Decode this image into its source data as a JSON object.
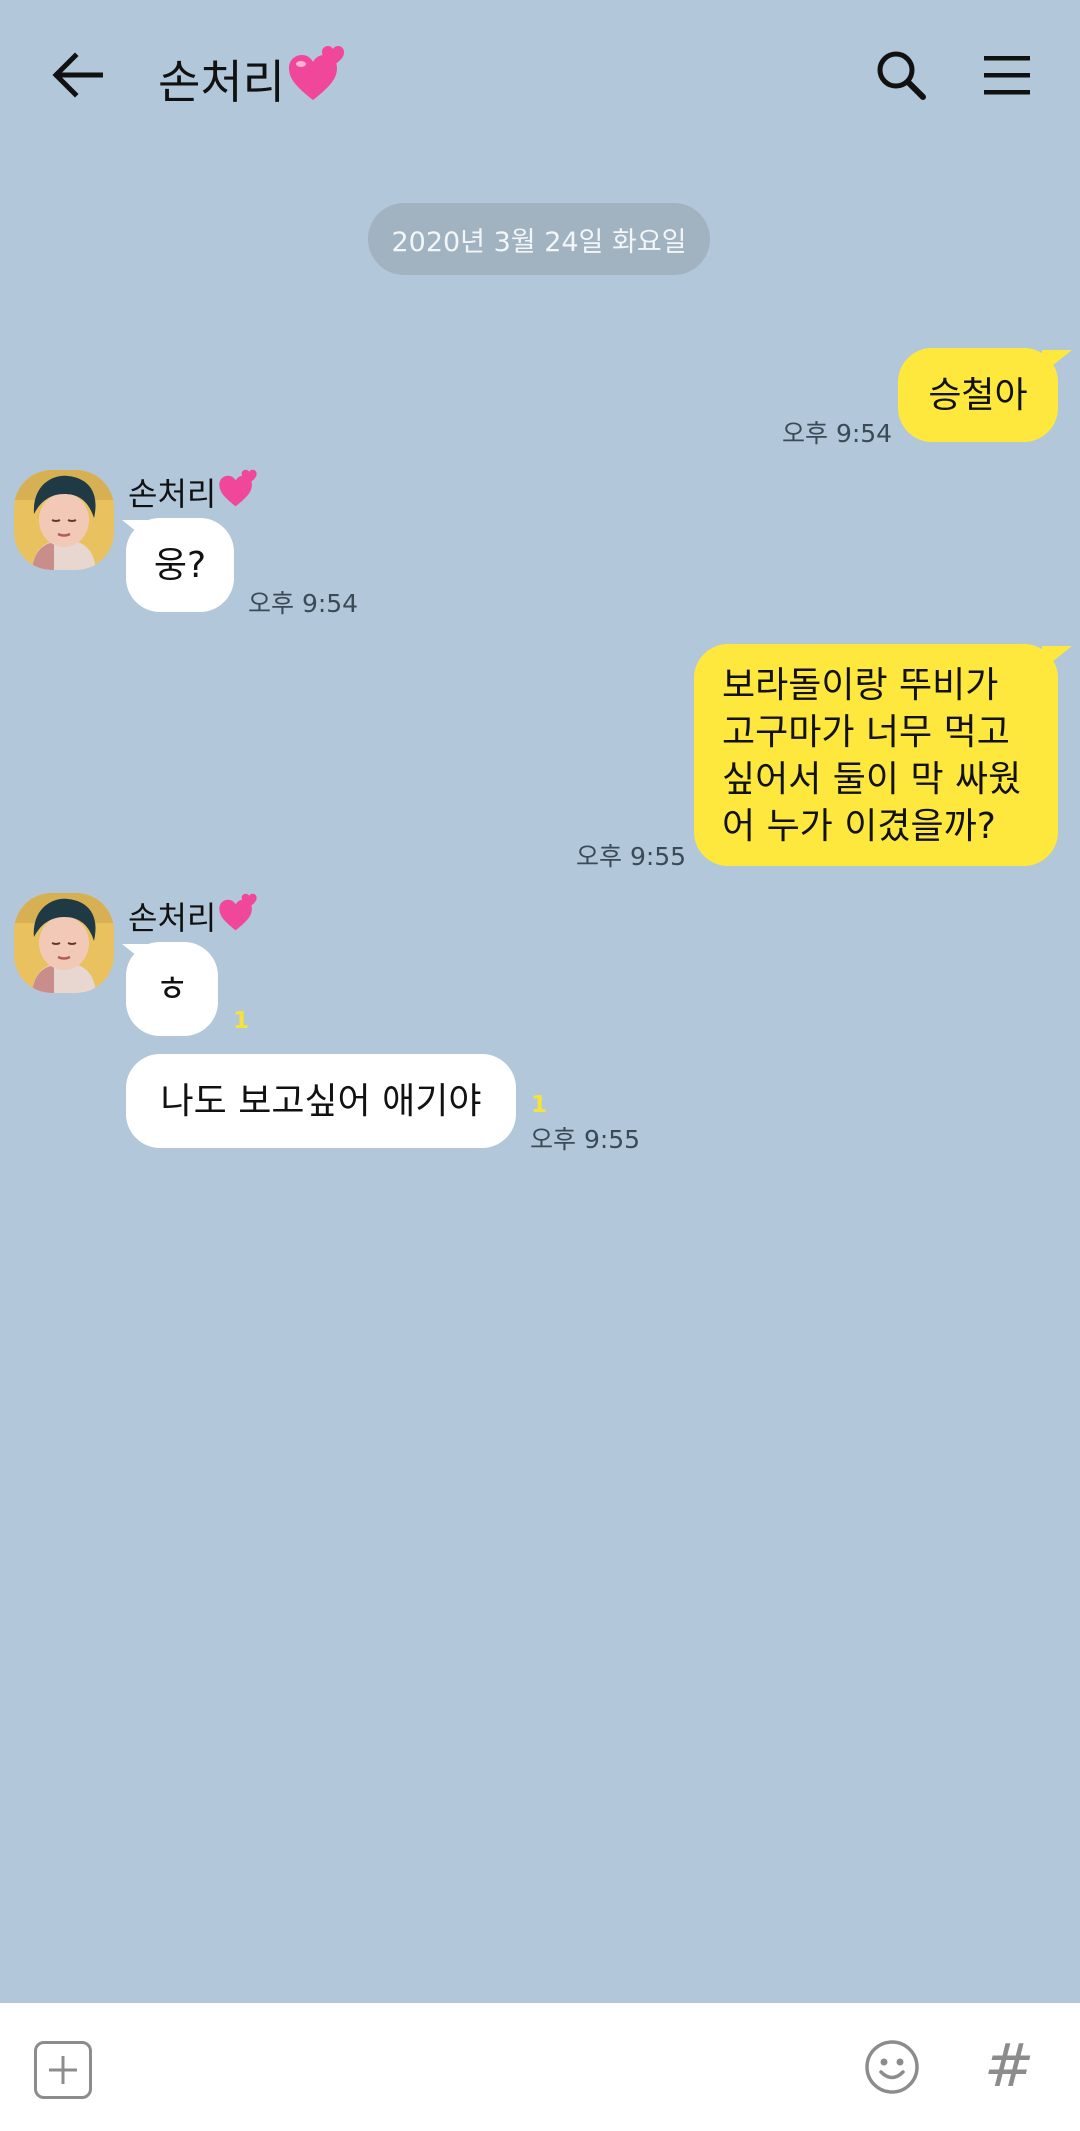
{
  "header": {
    "title": "손처리",
    "title_emoji": "💕"
  },
  "date_divider": "2020년 3월 24일 화요일",
  "messages": [
    {
      "from": "me",
      "text": "승철아",
      "time": "오후 9:54"
    },
    {
      "from": "other",
      "sender": "손처리",
      "sender_emoji": "💕",
      "text": "웅?",
      "time": "오후 9:54"
    },
    {
      "from": "me",
      "lines": [
        "보라돌이랑 뚜비가",
        "고구마가 너무 먹고",
        "싶어서 둘이 막 싸웠",
        "어 누가 이겼을까?"
      ],
      "time": "오후 9:55"
    },
    {
      "from": "other",
      "sender": "손처리",
      "sender_emoji": "💕",
      "text": "ㅎ",
      "unread": "1"
    },
    {
      "from": "other",
      "text": "나도 보고싶어 애기야",
      "unread": "1",
      "time": "오후 9:55"
    }
  ],
  "bottom_bar": {
    "hash": "#"
  },
  "colors": {
    "background": "#b2c7d9",
    "my_bubble": "#fee83d",
    "other_bubble": "#ffffff",
    "date_pill": "#a1b2c0",
    "unread": "#f5e23a"
  },
  "icons": [
    "back-arrow-icon",
    "search-icon",
    "menu-icon",
    "plus-icon",
    "emoji-icon",
    "hashtag-icon",
    "heart-emoji"
  ]
}
